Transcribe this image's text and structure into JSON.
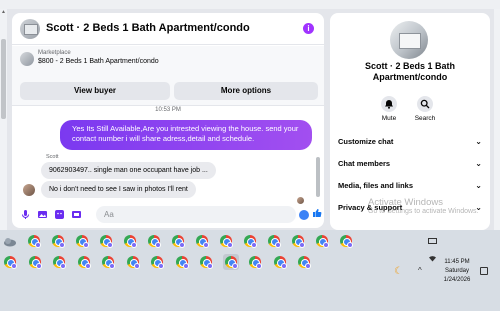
{
  "chat": {
    "title": "Scott · 2 Beds 1 Bath Apartment/condo",
    "info_icon": "i",
    "listing": {
      "source": "Marketplace",
      "price_title": "$800 - 2 Beds 1 Bath Apartment/condo",
      "view_buyer_label": "View buyer",
      "more_options_label": "More options"
    },
    "timestamp": "10:53 PM",
    "messages": {
      "outgoing_1": "Yes Its Still Available,Are you intrested viewing the house. send your contact number i will share adress,detail and schedule.",
      "sender_name": "Scott",
      "incoming_1": "9062903497.. single man one occupant have job ...",
      "incoming_2": "No i don't need to see I saw in photos I'll rent"
    },
    "composer": {
      "placeholder": "Aa",
      "value": ""
    }
  },
  "info_panel": {
    "title": "Scott · 2 Beds 1 Bath Apartment/condo",
    "actions": {
      "mute_label": "Mute",
      "search_label": "Search"
    },
    "sections": {
      "customize": "Customize chat",
      "members": "Chat members",
      "media": "Media, files and links",
      "privacy": "Privacy & support"
    }
  },
  "watermark": {
    "line1": "Activate Windows",
    "line2": "Go to Settings to activate Windows."
  },
  "taskbar": {
    "clock_time": "11:45 PM",
    "clock_day": "Saturday",
    "clock_date": "1/24/2026"
  },
  "colors": {
    "accent": "#8a2be2",
    "messenger_blue": "#1877f2"
  }
}
